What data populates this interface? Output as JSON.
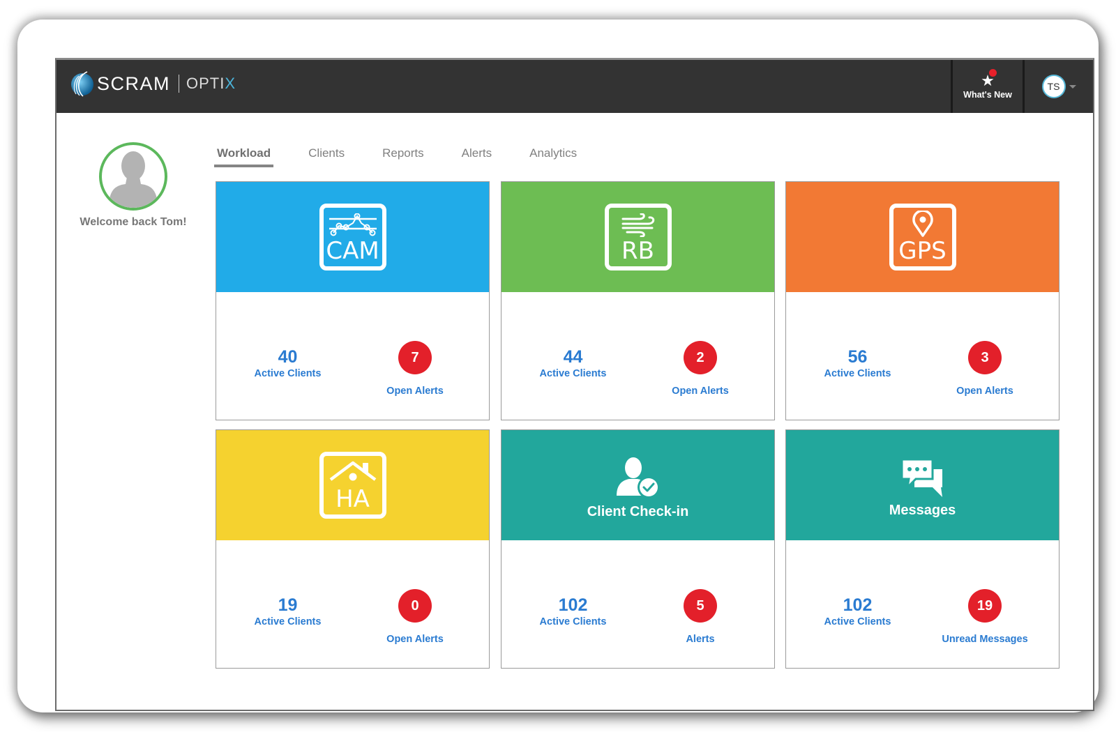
{
  "header": {
    "brand": "SCRAM",
    "product_prefix": "OPTI",
    "product_suffix": "X",
    "whats_new_label": "What's New",
    "user_initials": "TS"
  },
  "colors": {
    "topbar": "#333333",
    "accent_blue": "#2a7bd1",
    "alert_red": "#e3202a",
    "profile_ring": "#5cb85c"
  },
  "profile": {
    "welcome": "Welcome back Tom!"
  },
  "tabs": [
    {
      "label": "Workload",
      "active": true
    },
    {
      "label": "Clients",
      "active": false
    },
    {
      "label": "Reports",
      "active": false
    },
    {
      "label": "Alerts",
      "active": false
    },
    {
      "label": "Analytics",
      "active": false
    }
  ],
  "tiles": [
    {
      "abbr": "CAM",
      "icon": "anklet-chain-icon",
      "color": "#21abe8",
      "active_count": "40",
      "active_label": "Active Clients",
      "badge_count": "7",
      "badge_label": "Open Alerts"
    },
    {
      "abbr": "RB",
      "icon": "breath-wind-icon",
      "color": "#6dbd53",
      "active_count": "44",
      "active_label": "Active Clients",
      "badge_count": "2",
      "badge_label": "Open Alerts"
    },
    {
      "abbr": "GPS",
      "icon": "map-pin-icon",
      "color": "#f27934",
      "active_count": "56",
      "active_label": "Active Clients",
      "badge_count": "3",
      "badge_label": "Open Alerts"
    },
    {
      "abbr": "HA",
      "icon": "house-icon",
      "color": "#f5d22f",
      "active_count": "19",
      "active_label": "Active Clients",
      "badge_count": "0",
      "badge_label": "Open Alerts"
    },
    {
      "title": "Client Check-in",
      "icon": "user-check-icon",
      "color": "#22a79c",
      "active_count": "102",
      "active_label": "Active Clients",
      "badge_count": "5",
      "badge_label": "Alerts"
    },
    {
      "title": "Messages",
      "icon": "chat-bubbles-icon",
      "color": "#22a79c",
      "active_count": "102",
      "active_label": "Active Clients",
      "badge_count": "19",
      "badge_label": "Unread Messages"
    }
  ]
}
